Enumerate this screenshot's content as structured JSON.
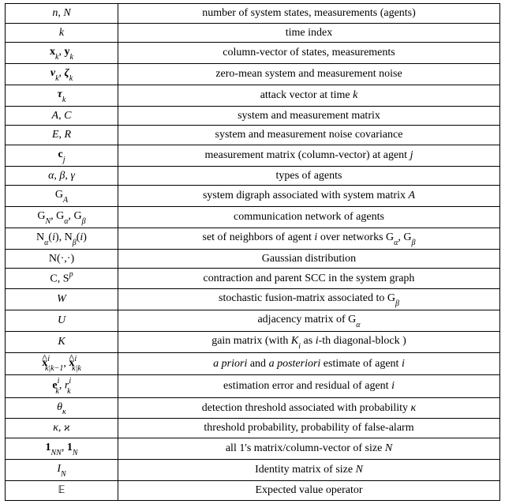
{
  "rows": [
    {
      "s": "<span class='it'>n</span>, <span class='it'>N</span>",
      "d": "number of system states, measurements (agents)"
    },
    {
      "s": "<span class='it'>k</span>",
      "d": "time index"
    },
    {
      "s": "<span class='bf'>x</span><span class='it sub'>k</span>, <span class='bf'>y</span><span class='it sub'>k</span>",
      "d": "column-vector of states, measurements"
    },
    {
      "s": "<span class='bf it'>ν</span><span class='it sub'>k</span>, <span class='bf it'>ζ</span><span class='it sub'>k</span>",
      "d": "zero-mean system and measurement noise"
    },
    {
      "s": "<span class='bf it'>τ</span><span class='it sub'>k</span>",
      "d": "attack vector at time <span class='it'>k</span>"
    },
    {
      "s": "<span class='it'>A</span>, <span class='it'>C</span>",
      "d": "system and measurement matrix"
    },
    {
      "s": "<span class='it'>E</span>, <span class='it'>R</span>",
      "d": "system and measurement noise covariance"
    },
    {
      "s": "<span class='bf'>c</span><span class='it sub'>j</span>",
      "d": "measurement matrix (column-vector) at agent <span class='it'>j</span>"
    },
    {
      "s": "<span class='it'>α</span>, <span class='it'>β</span>, <span class='it'>γ</span>",
      "d": "types of agents"
    },
    {
      "s": "<span class='cal'>G</span><span class='it sub'>A</span>",
      "d": "system digraph associated with system matrix <span class='it'>A</span>"
    },
    {
      "s": "<span class='cal'>G</span><span class='it sub'>N</span>, <span class='cal'>G</span><span class='it sub'>α</span>, <span class='cal'>G</span><span class='it sub'>β</span>",
      "d": "communication network of agents"
    },
    {
      "s": "<span class='cal'>N</span><span class='it sub'>α</span>(<span class='it'>i</span>), <span class='cal'>N</span><span class='it sub'>β</span>(<span class='it'>i</span>)",
      "d": "set of neighbors of agent <span class='it'>i</span> over networks <span class='cal'>G</span><span class='it sub'>α</span>, <span class='cal'>G</span><span class='it sub'>β</span>"
    },
    {
      "s": "<span class='cal'>N</span>(·,·)",
      "d": "Gaussian distribution"
    },
    {
      "s": "<span class='cal'>C</span>, <span class='cal'>S</span><span class='it sup'>p</span>",
      "d": "contraction and parent SCC in the system graph"
    },
    {
      "s": "<span class='it'>W</span>",
      "d": "stochastic fusion-matrix associated to <span class='cal'>G</span><span class='it sub'>β</span>"
    },
    {
      "s": "<span class='it'>U</span>",
      "d": "adjacency matrix of <span class='cal'>G</span><span class='it sub'>α</span>"
    },
    {
      "s": "<span class='it'>K</span>",
      "d": "gain matrix (with <span class='it'>K<span class='sub'>i</span></span> as <span class='it'>i</span>-th diagonal-block )"
    },
    {
      "s": "<span style='position:relative'><span style='position:absolute;left:0;top:-7px'>^</span><span class='bf'>x</span></span><span class='it sup'>i</span><span class='it sub' style='margin-left:-6px'>k|k−1</span>, <span style='position:relative'><span style='position:absolute;left:0;top:-7px'>^</span><span class='bf'>x</span></span><span class='it sup'>i</span><span class='it sub' style='margin-left:-6px'>k|k</span>",
      "d": "<span class='it'>a priori</span> and <span class='it'>a posteriori</span> estimate of agent <span class='it'>i</span>"
    },
    {
      "s": "<span class='bf'>e</span><span class='it sup'>i</span><span class='it sub' style='margin-left:-5px'>k</span>, <span class='it'>r</span><span class='it sup'>i</span><span class='it sub' style='margin-left:-5px'>k</span>",
      "d": "estimation error and residual of agent <span class='it'>i</span>"
    },
    {
      "s": "<span class='it'>θ</span><span class='it sub'>κ</span>",
      "d": "detection threshold associated with probability <span class='it'>κ</span>"
    },
    {
      "s": "<span class='it'>κ</span>, <span class='it'>ϰ</span>",
      "d": "threshold probability, probability of false-alarm"
    },
    {
      "s": "<span class='bf'>1</span><span class='it sub'>NN</span>, <span class='bf'>1</span><span class='it sub'>N</span>",
      "d": "all 1's matrix/column-vector of size <span class='it'>N</span>"
    },
    {
      "s": "<span class='it'>I<span class='sub'>N</span></span>",
      "d": "Identity matrix of size <span class='it'>N</span>"
    },
    {
      "s": "<span class='bb'>𝔼</span>",
      "d": "Expected value operator"
    }
  ]
}
